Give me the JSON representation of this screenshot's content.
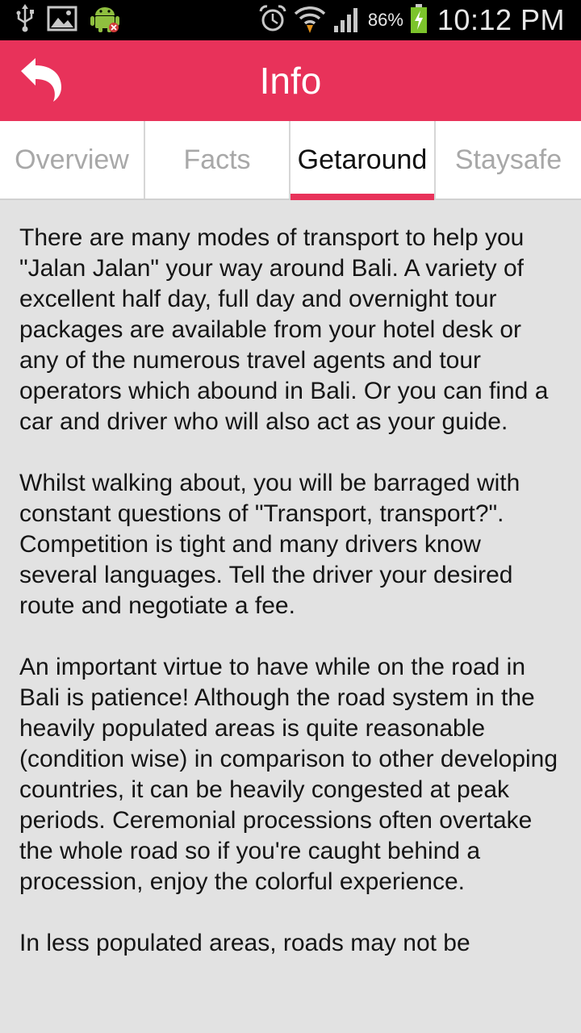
{
  "status_bar": {
    "left_icons": [
      "usb-icon",
      "image-icon",
      "android-debug-icon"
    ],
    "right_icons": [
      "alarm-icon",
      "wifi-icon",
      "signal-icon",
      "battery-charging-icon"
    ],
    "battery_percent": "86%",
    "time": "10:12 PM"
  },
  "app_bar": {
    "title": "Info",
    "back_icon": "back-arrow-icon",
    "color": "#e8325a"
  },
  "tabs": [
    {
      "label": "Overview",
      "active": false
    },
    {
      "label": "Facts",
      "active": false
    },
    {
      "label": "Getaround",
      "active": true
    },
    {
      "label": "Staysafe",
      "active": false
    }
  ],
  "content": {
    "paragraphs": [
      "There are many modes of transport to help you \"Jalan Jalan\" your way around Bali. A variety of excellent half day, full day and overnight tour packages are available from your hotel desk or any of the numerous travel agents and tour operators which abound in Bali. Or you can find a car and driver who will also act as your guide.",
      "Whilst walking about, you will be barraged with constant questions of \"Transport, transport?\". Competition is tight and many drivers know several languages. Tell the driver your desired route and negotiate a fee.",
      "An important virtue to have while on the road in Bali is patience! Although the road system in the heavily populated areas is quite reasonable (condition wise) in comparison to other developing countries, it can be heavily congested at peak periods. Ceremonial processions often overtake the whole road so if you're caught behind a procession, enjoy the colorful experience.",
      "In less populated areas, roads may not be"
    ]
  }
}
